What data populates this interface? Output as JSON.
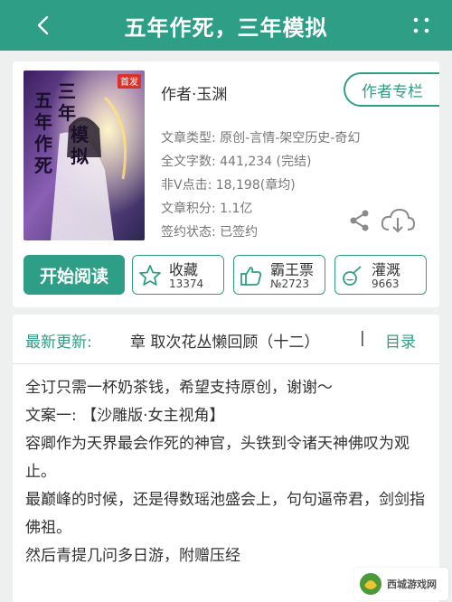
{
  "header": {
    "title": "五年作死，三年模拟"
  },
  "book": {
    "cover_badge": "首发",
    "author": "作者·玉渊",
    "author_page_label": "作者专栏",
    "meta": [
      "文章类型: 原创-言情-架空历史-奇幻",
      "全文字数: 441,234 (完结)",
      "非V点击: 18,198(章均)",
      "文章积分: 1.1亿",
      "签约状态:  已签约"
    ],
    "read_label": "开始阅读",
    "actions": [
      {
        "label": "收藏",
        "count": "13374"
      },
      {
        "label": "霸王票",
        "count": "№2723"
      },
      {
        "label": "灌溉",
        "count": "9663"
      }
    ]
  },
  "update": {
    "prefix": "最新更新:",
    "chapter": "章  取次花丛懒回顾（十二）",
    "separator": "|",
    "toc_label": "目录"
  },
  "synopsis": [
    "全订只需一杯奶茶钱，希望支持原创，谢谢～",
    "文案一:  【沙雕版·女主视角】",
    "容卿作为天界最会作死的神官，头铁到令诸天神佛叹为观止。",
    "最巅峰的时候，还是得数瑶池盛会上，句句逼帝君，剑剑指佛祖。",
    "然后青提几问多日游，附赠压经"
  ],
  "watermark": "西城游戏网",
  "colors": {
    "accent": "#2e9f86"
  }
}
